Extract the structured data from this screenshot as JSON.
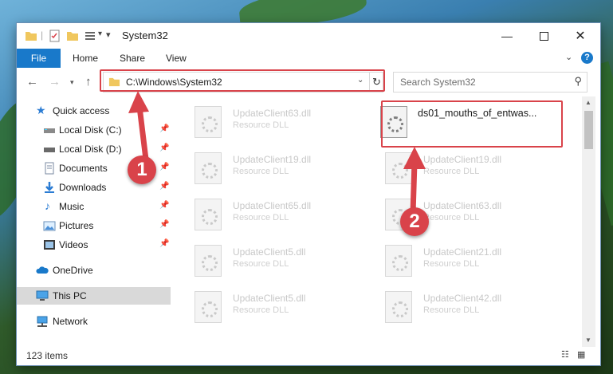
{
  "window": {
    "title": "System32"
  },
  "ribbon": {
    "file": "File",
    "home": "Home",
    "share": "Share",
    "view": "View",
    "help": "?"
  },
  "address": {
    "path": "C:\\Windows\\System32",
    "refresh": "↻",
    "dropdown": "⌄"
  },
  "search": {
    "placeholder": "Search System32"
  },
  "sidebar": {
    "items": [
      {
        "label": "Quick access",
        "icon": "star-icon"
      },
      {
        "label": "Local Disk (C:)",
        "icon": "drive-icon"
      },
      {
        "label": "Local Disk (D:)",
        "icon": "drive-icon"
      },
      {
        "label": "Documents",
        "icon": "documents-icon"
      },
      {
        "label": "Downloads",
        "icon": "download-icon"
      },
      {
        "label": "Music",
        "icon": "music-icon"
      },
      {
        "label": "Pictures",
        "icon": "pictures-icon"
      },
      {
        "label": "Videos",
        "icon": "videos-icon"
      },
      {
        "label": "OneDrive",
        "icon": "cloud-icon"
      },
      {
        "label": "This PC",
        "icon": "computer-icon"
      },
      {
        "label": "Network",
        "icon": "network-icon"
      }
    ]
  },
  "files": {
    "col1": [
      {
        "name": "UpdateClient63.dll",
        "type": "Resource DLL"
      },
      {
        "name": "UpdateClient19.dll",
        "type": "Resource DLL"
      },
      {
        "name": "UpdateClient65.dll",
        "type": "Resource DLL"
      },
      {
        "name": "UpdateClient5.dll",
        "type": "Resource DLL"
      },
      {
        "name": "UpdateClient5.dll",
        "type": "Resource DLL"
      }
    ],
    "col2": [
      {
        "name": "ds01_mouths_of_entwas...",
        "type": ""
      },
      {
        "name": "UpdateClient19.dll",
        "type": "Resource DLL"
      },
      {
        "name": "UpdateClient63.dll",
        "type": "Resource DLL"
      },
      {
        "name": "UpdateClient21.dll",
        "type": "Resource DLL"
      },
      {
        "name": "UpdateClient42.dll",
        "type": "Resource DLL"
      }
    ]
  },
  "status": {
    "count": "123 items"
  },
  "annotations": {
    "step1": "1",
    "step2": "2"
  },
  "colors": {
    "accent": "#1979ca",
    "highlight": "#d9434a",
    "selected": "#cde8ff"
  }
}
